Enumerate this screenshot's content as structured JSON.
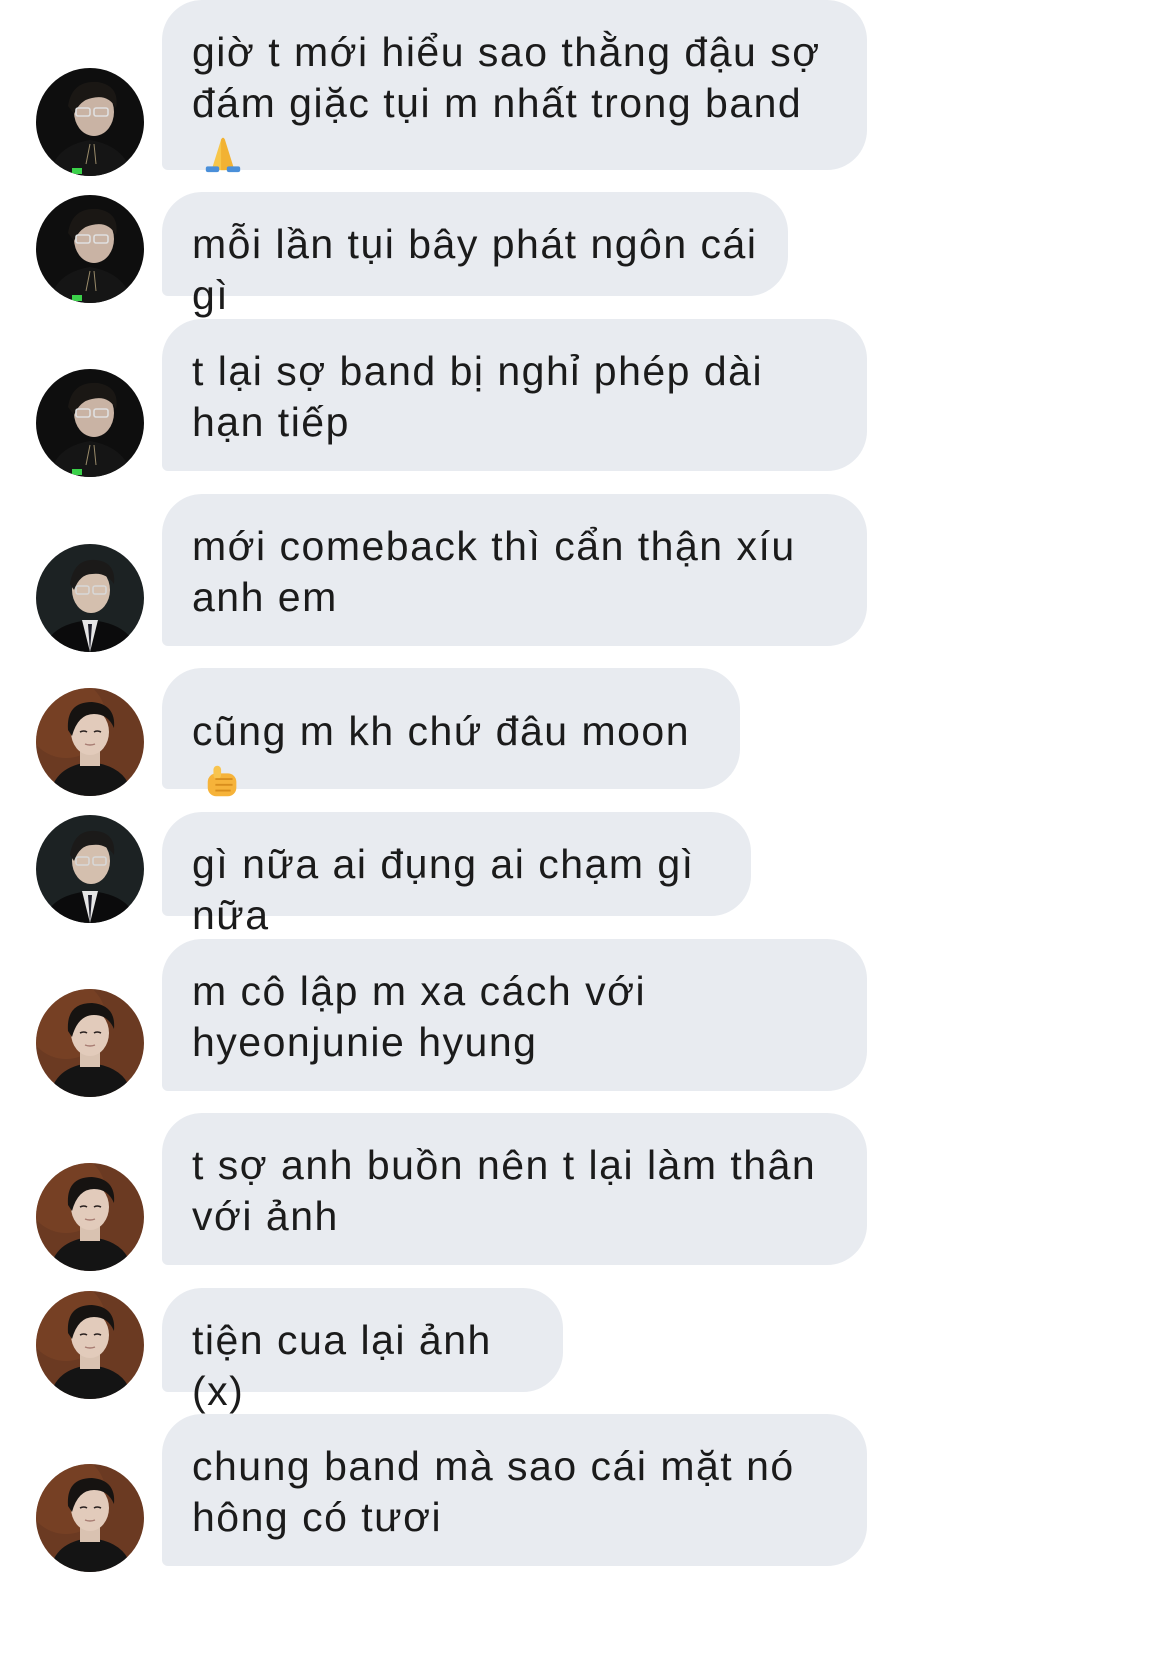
{
  "conversation": {
    "messages": [
      {
        "sender": "member-a",
        "avatar": "avatar-glasses-black-hoodie",
        "text": "giờ t mới hiểu sao thằng đậu sợ đám giặc tụi m nhất trong band",
        "emoji": "folded-hands-emoji"
      },
      {
        "sender": "member-a",
        "avatar": "avatar-glasses-black-hoodie",
        "text": "mỗi lần tụi bây phát ngôn cái gì"
      },
      {
        "sender": "member-a",
        "avatar": "avatar-glasses-black-hoodie",
        "text": "t lại sợ band bị nghỉ phép dài hạn tiếp"
      },
      {
        "sender": "member-b",
        "avatar": "avatar-glasses-suit",
        "text": "mới comeback thì cẩn thận xíu anh em"
      },
      {
        "sender": "member-c",
        "avatar": "avatar-brown-background",
        "text": "cũng m kh chứ đâu moon",
        "emoji": "pointing-finger-emoji"
      },
      {
        "sender": "member-b",
        "avatar": "avatar-glasses-suit",
        "text": "gì nữa ai đụng ai chạm gì nữa"
      },
      {
        "sender": "member-c",
        "avatar": "avatar-brown-background",
        "text": "m cô lập m xa cách với hyeonjunie hyung"
      },
      {
        "sender": "member-c",
        "avatar": "avatar-brown-background",
        "text": "t sợ anh buồn nên t lại làm thân với ảnh"
      },
      {
        "sender": "member-c",
        "avatar": "avatar-brown-background",
        "text": "tiện cua lại ảnh (x)"
      },
      {
        "sender": "member-c",
        "avatar": "avatar-brown-background",
        "text": "chung band mà sao cái mặt nó hông có tươi"
      }
    ]
  },
  "colors": {
    "bubble_background": "#e8ebf0",
    "text": "#1b1b1b",
    "page_background": "#ffffff"
  }
}
